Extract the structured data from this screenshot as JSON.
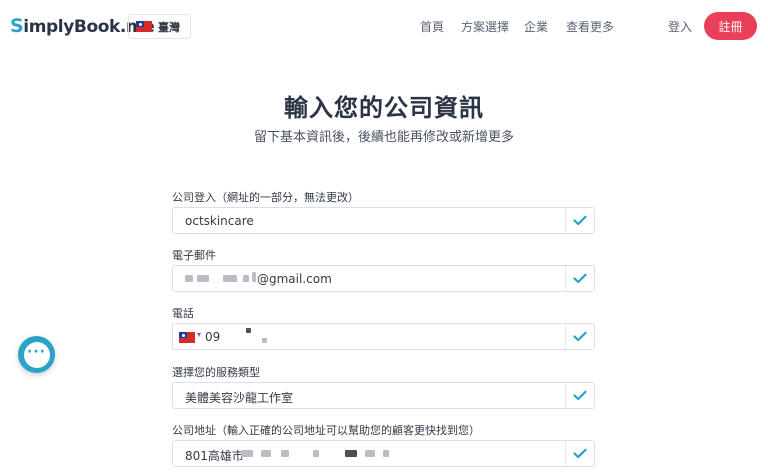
{
  "header": {
    "logo_s": "S",
    "logo_rest": "implyBook.me",
    "language": "臺灣",
    "nav": [
      "首頁",
      "方案選擇",
      "企業",
      "查看更多"
    ],
    "login": "登入",
    "signup": "註冊"
  },
  "main": {
    "title": "輸入您的公司資訊",
    "subtitle": "留下基本資訊後，後續也能再修改或新增更多"
  },
  "form": {
    "company_login": {
      "label": "公司登入（網址的一部分，無法更改）",
      "value": "octskincare"
    },
    "email": {
      "label": "電子郵件",
      "value": "@gmail.com"
    },
    "phone": {
      "label": "電話",
      "value": "09"
    },
    "service_type": {
      "label": "選擇您的服務類型",
      "value": "美體美容沙龍工作室"
    },
    "address": {
      "label": "公司地址（輸入正確的公司地址可以幫助您的顧客更快找到您）",
      "value": "801高雄市"
    }
  },
  "colors": {
    "brand": "#2ba2c9",
    "signup": "#e93f5b",
    "check": "#2ba2c9"
  },
  "icons": [
    "flag-tw-icon",
    "check-icon",
    "chat-icon",
    "chevron-down-icon"
  ]
}
